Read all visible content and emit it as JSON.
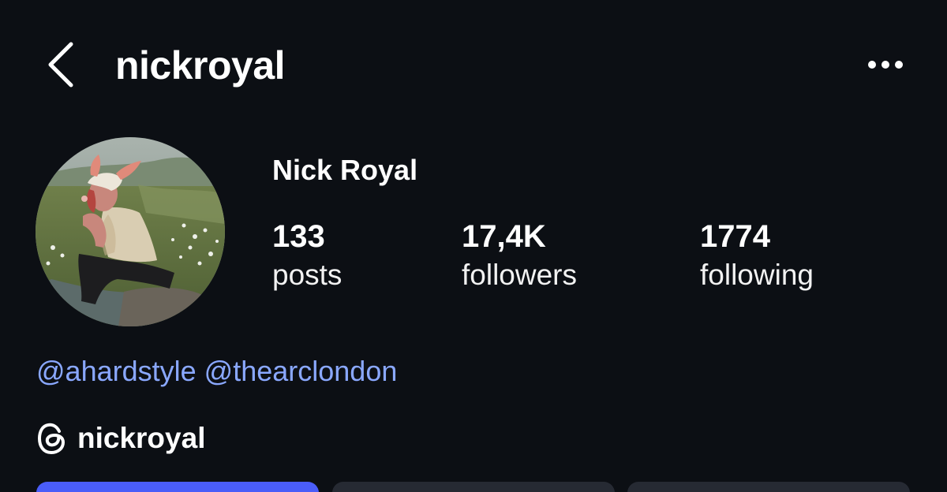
{
  "header": {
    "username": "nickroyal",
    "back_icon": "chevron-left-icon",
    "more_icon": "more-horizontal-icon"
  },
  "profile": {
    "display_name": "Nick Royal",
    "stats": [
      {
        "value": "133",
        "label": "posts"
      },
      {
        "value": "17,4K",
        "label": "followers"
      },
      {
        "value": "1774",
        "label": "following"
      }
    ],
    "bio_mentions": [
      "@ahardstyle",
      "@thearclondon"
    ],
    "threads": {
      "icon": "threads-icon",
      "label": "nickroyal"
    }
  },
  "colors": {
    "background": "#0c0f14",
    "mention_link": "#8aa8ff",
    "primary_button": "#4a5df9",
    "secondary_button": "#262a33"
  }
}
